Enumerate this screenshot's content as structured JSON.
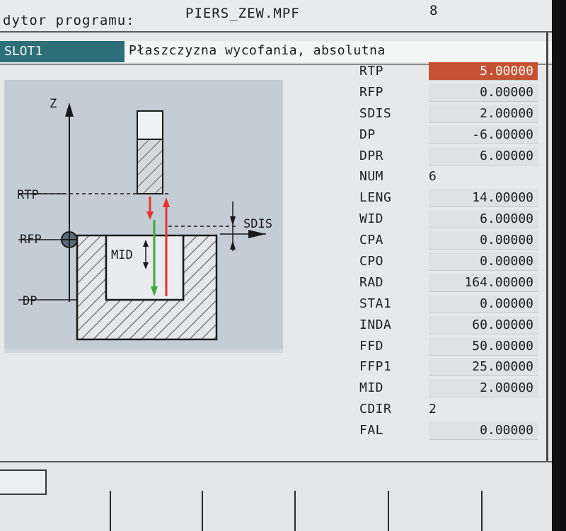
{
  "header": {
    "editor_label": "dytor programu:",
    "file_name": "PIERS_ZEW.MPF",
    "line_number": "8"
  },
  "slot": {
    "name": "SLOT1",
    "description": "Płaszczyzna wycofania, absolutna"
  },
  "diagram": {
    "axis_z": "Z",
    "rtp": "RTP",
    "rfp": "RFP",
    "dp": "DP",
    "sdis": "SDIS",
    "mid": "MID"
  },
  "colors": {
    "active_field": "#c45335",
    "slot_bar": "#2d6e78",
    "arrow_red": "#e0362c",
    "arrow_green": "#3fa83c"
  },
  "params": [
    {
      "name": "RTP",
      "value": "5.00000",
      "active": true
    },
    {
      "name": "RFP",
      "value": "0.00000"
    },
    {
      "name": "SDIS",
      "value": "2.00000"
    },
    {
      "name": "DP",
      "value": "-6.00000"
    },
    {
      "name": "DPR",
      "value": "6.00000"
    },
    {
      "name": "NUM",
      "value": "6",
      "plain": true
    },
    {
      "name": "LENG",
      "value": "14.00000"
    },
    {
      "name": "WID",
      "value": "6.00000"
    },
    {
      "name": "CPA",
      "value": "0.00000"
    },
    {
      "name": "CPO",
      "value": "0.00000"
    },
    {
      "name": "RAD",
      "value": "164.00000"
    },
    {
      "name": "STA1",
      "value": "0.00000"
    },
    {
      "name": "INDA",
      "value": "60.00000"
    },
    {
      "name": "FFD",
      "value": "50.00000"
    },
    {
      "name": "FFP1",
      "value": "25.00000"
    },
    {
      "name": "MID",
      "value": "2.00000"
    },
    {
      "name": "CDIR",
      "value": "2",
      "plain": true
    },
    {
      "name": "FAL",
      "value": "0.00000"
    }
  ]
}
